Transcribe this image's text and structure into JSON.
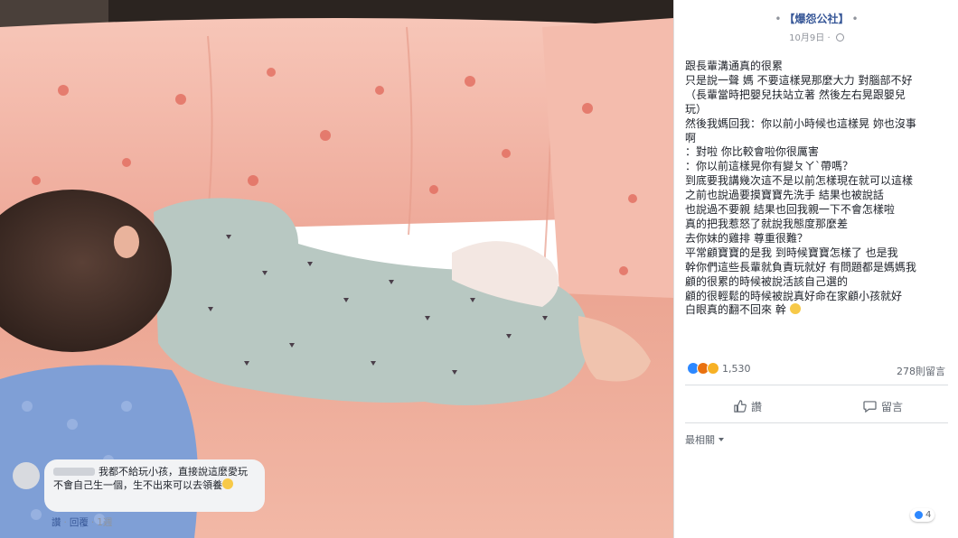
{
  "header": {
    "page_name": "【爆怨公社】",
    "date": "10月9日"
  },
  "post": {
    "lines": [
      "跟長輩溝通真的很累",
      "只是說一聲 媽 不要這樣晃那麼大力 對腦部不好",
      "（長輩當時把嬰兒扶站立著 然後左右晃跟嬰兒",
      "玩）",
      "然後我媽回我：你以前小時候也這樣晃 妳也沒事",
      "啊",
      "：對啦 你比較會啦你很厲害",
      "：你以前這樣晃你有變ㄆㄚˋ帶嗎？",
      "到底要我講幾次這不是以前怎樣現在就可以這樣",
      "之前也說過要摸寶寶先洗手 結果也被說話",
      "也說過不要親 結果也回我親一下不會怎樣啦",
      "真的把我惹怒了就說我態度那麼差",
      "去你妹的雞排 尊重很難？",
      "平常顧寶寶的是我 到時候寶寶怎樣了 也是我",
      "幹你們這些長輩就負責玩就好 有問題都是媽媽我",
      "顧的很累的時候被說活該自己選的",
      "顧的很輕鬆的時候被說真好命在家顧小孩就好",
      "白眼真的翻不回來 幹"
    ],
    "last_line_emoji": "grinning-sweat-emoji"
  },
  "reactions": {
    "icons": [
      "like-reaction",
      "angry-reaction",
      "wow-reaction"
    ],
    "count": "1,530",
    "comments": "278則留言"
  },
  "actions": {
    "like": "讚",
    "comment": "留言"
  },
  "sort": {
    "label": "最相關"
  },
  "comment": {
    "text": "我都不給玩小孩，直接說這麼愛玩不會自己生一個，生不出來可以去領養",
    "emoji": "grinning-sweat-emoji",
    "like_label": "讚",
    "reply_label": "回覆",
    "time": "1週",
    "reaction_count": "4"
  },
  "colors": {
    "accent": "#385898",
    "like_blue": "#2d88ff",
    "crib_pink": "#f3b7a6",
    "onesie": "#b8c8c2"
  }
}
